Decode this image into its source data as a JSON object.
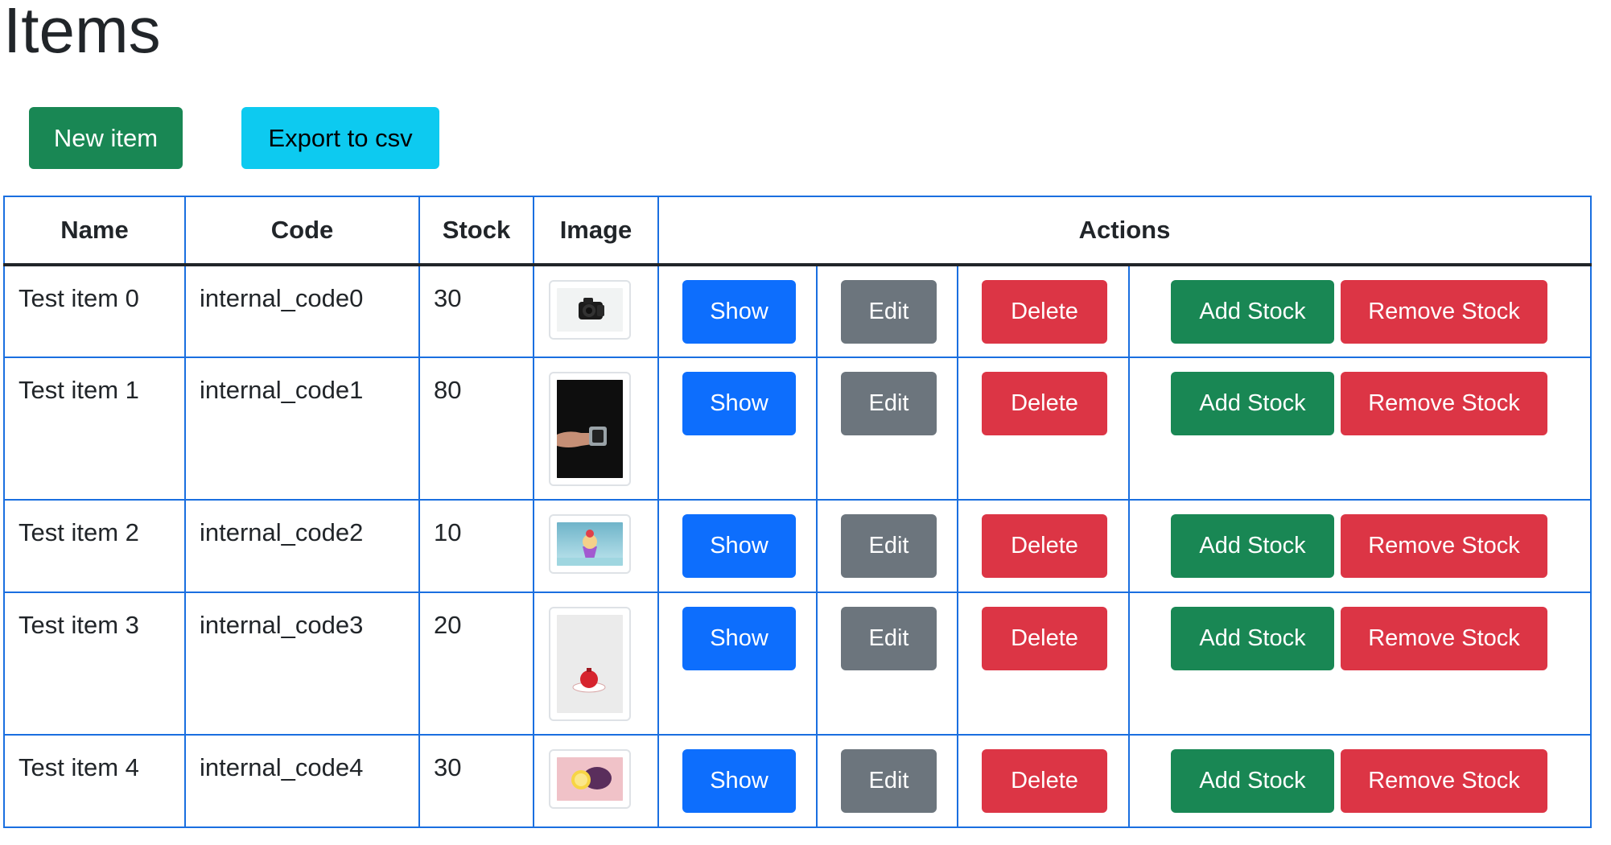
{
  "page": {
    "title": "Items",
    "new_item_label": "New item",
    "export_label": "Export to csv"
  },
  "table": {
    "headers": {
      "name": "Name",
      "code": "Code",
      "stock": "Stock",
      "image": "Image",
      "actions": "Actions"
    },
    "action_labels": {
      "show": "Show",
      "edit": "Edit",
      "delete": "Delete",
      "add_stock": "Add Stock",
      "remove_stock": "Remove Stock"
    },
    "rows": [
      {
        "name": "Test item 0",
        "code": "internal_code0",
        "stock": "30",
        "image": "camera-photo"
      },
      {
        "name": "Test item 1",
        "code": "internal_code1",
        "stock": "80",
        "image": "hand-holding-device-photo"
      },
      {
        "name": "Test item 2",
        "code": "internal_code2",
        "stock": "10",
        "image": "dessert-cup-photo"
      },
      {
        "name": "Test item 3",
        "code": "internal_code3",
        "stock": "20",
        "image": "pomegranate-on-plate-photo"
      },
      {
        "name": "Test item 4",
        "code": "internal_code4",
        "stock": "30",
        "image": "lemon-on-pink-photo"
      }
    ]
  },
  "colors": {
    "success": "#198754",
    "info": "#0dcaf0",
    "primary": "#0d6efd",
    "secondary": "#6c757d",
    "danger": "#dc3545",
    "table_border": "#1a6fe0"
  }
}
